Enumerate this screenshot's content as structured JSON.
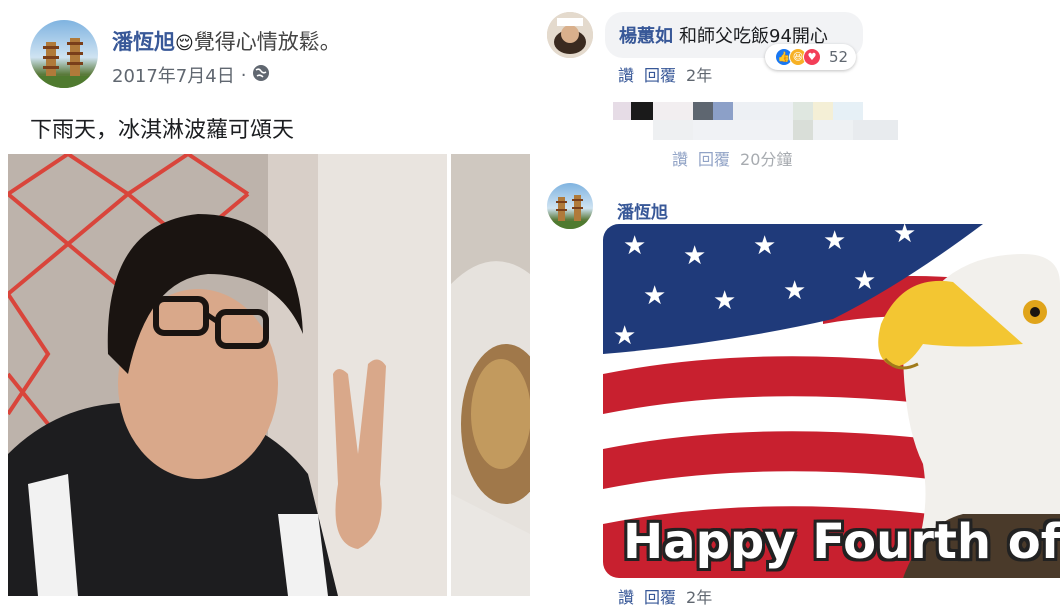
{
  "post": {
    "author": "潘恆旭",
    "feeling_emoji": "😌",
    "feeling_text": "覺得心情放鬆。",
    "date": "2017年7月4日",
    "dot": "·",
    "body": "下雨天，冰淇淋波蘿可頌天"
  },
  "comment1": {
    "author": "楊蕙如",
    "text": "和師父吃飯94開心",
    "reaction_count": "52",
    "like_label": "讚",
    "reply_label": "回覆",
    "age": "2年"
  },
  "comment2": {
    "like_label": "讚",
    "reply_label": "回覆",
    "age": "20分鐘"
  },
  "comment3": {
    "author": "潘恆旭",
    "image_caption": "Happy Fourth of Ju",
    "like_label": "讚",
    "reply_label": "回覆",
    "age": "2年"
  },
  "colors": {
    "accent": "#385898",
    "like_blue": "#1877f2",
    "haha_yellow": "#f7b125",
    "love_red": "#f33e58"
  }
}
